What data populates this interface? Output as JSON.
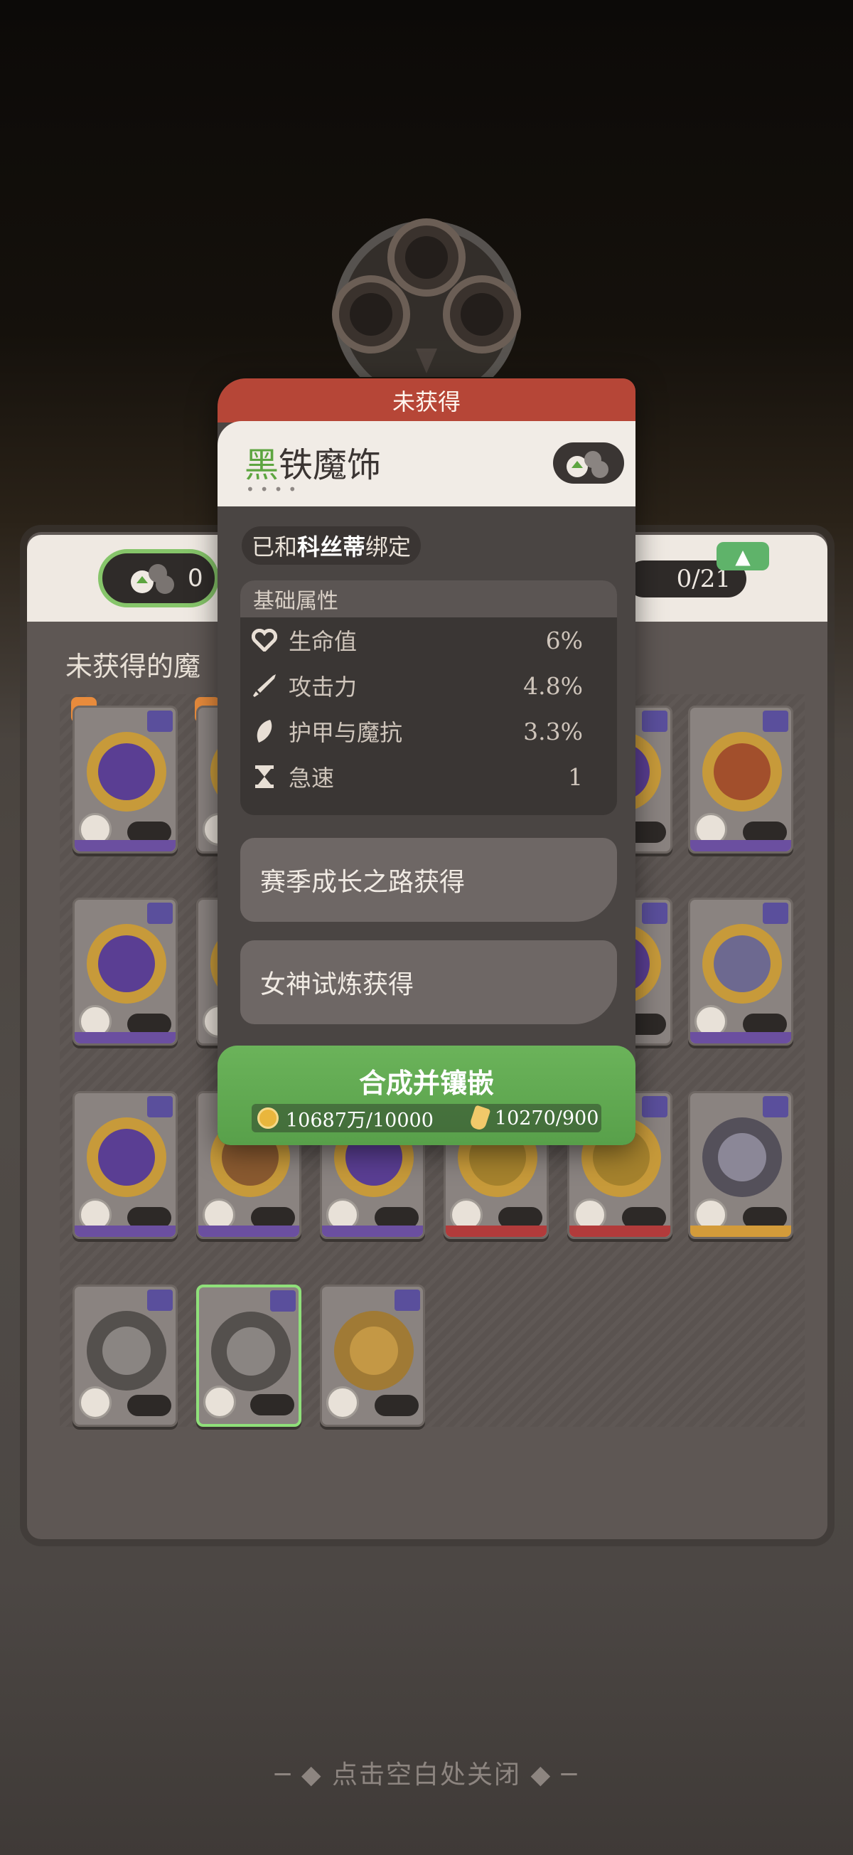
{
  "background": {
    "section_title": "未获得的魔",
    "counter_left": "0",
    "counter_right": "0/21",
    "close_hint": "─ ◆ 点击空白处关闭 ◆ ─"
  },
  "popup": {
    "status": "未获得",
    "item_name_first": "黑",
    "item_name_rest": "铁魔饰",
    "dots": "••••",
    "bound_prefix": "已和",
    "bound_name": "科丝蒂",
    "bound_suffix": "绑定",
    "attributes_title": "基础属性",
    "attributes": [
      {
        "icon": "heart-icon",
        "label": "生命值",
        "value": "6%"
      },
      {
        "icon": "sword-icon",
        "label": "攻击力",
        "value": "4.8%"
      },
      {
        "icon": "shield-icon",
        "label": "护甲与魔抗",
        "value": "3.3%"
      },
      {
        "icon": "hourglass-icon",
        "label": "急速",
        "value": "1"
      }
    ],
    "sources": [
      {
        "label": "赛季成长之路获得"
      },
      {
        "label": "女神试炼获得"
      }
    ],
    "craft": {
      "label": "合成并镶嵌",
      "coin_cost": "10687万/10000",
      "potion_cost": "10270/900"
    }
  },
  "colors": {
    "status_red": "#b64637",
    "accent_green": "#5da540",
    "craft_green": "#6bb35a"
  }
}
